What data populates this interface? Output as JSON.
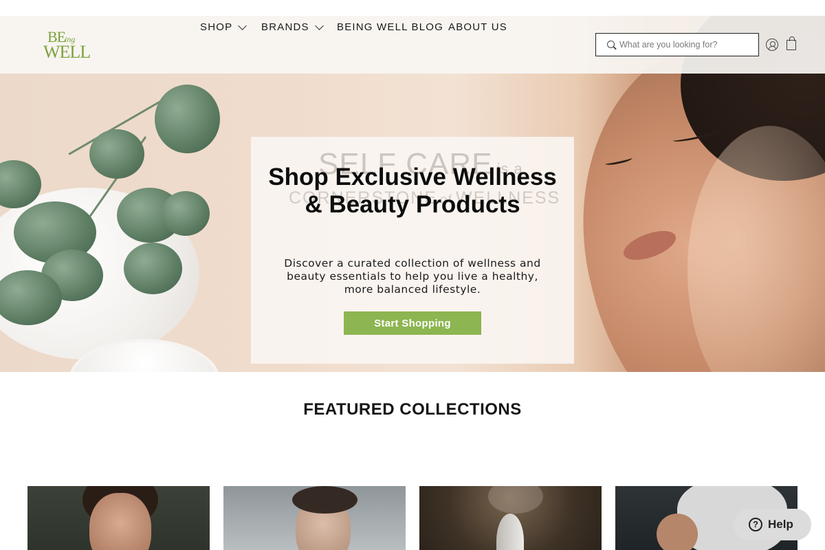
{
  "header": {
    "logo": {
      "be": "BE",
      "ing": "ing",
      "well": "WELL"
    },
    "nav": [
      {
        "label": "SHOP",
        "has_dropdown": true
      },
      {
        "label": "BRANDS",
        "has_dropdown": true
      },
      {
        "label": "BEING WELL BLOG",
        "has_dropdown": false
      },
      {
        "label": "ABOUT US",
        "has_dropdown": false
      }
    ],
    "search": {
      "placeholder": "What are you looking for?",
      "value": "",
      "icon": "search-icon"
    },
    "account_icon": "user-icon",
    "cart_icon": "shopping-bag-icon"
  },
  "hero": {
    "background_text": {
      "line1": "SELF CARE",
      "line1_small": "is a",
      "line2": "CORNERSTONE",
      "line2_small": "of",
      "line3": "WELLNESS"
    },
    "title": "Shop Exclusive Wellness & Beauty Products",
    "subtitle": "Discover a curated collection of wellness and beauty essentials to help you live a healthy, more balanced lifestyle.",
    "cta_label": "Start Shopping",
    "cta_color": "#8db551"
  },
  "featured": {
    "title": "FEATURED COLLECTIONS"
  },
  "help_widget": {
    "label": "Help",
    "icon": "question-mark-icon"
  }
}
